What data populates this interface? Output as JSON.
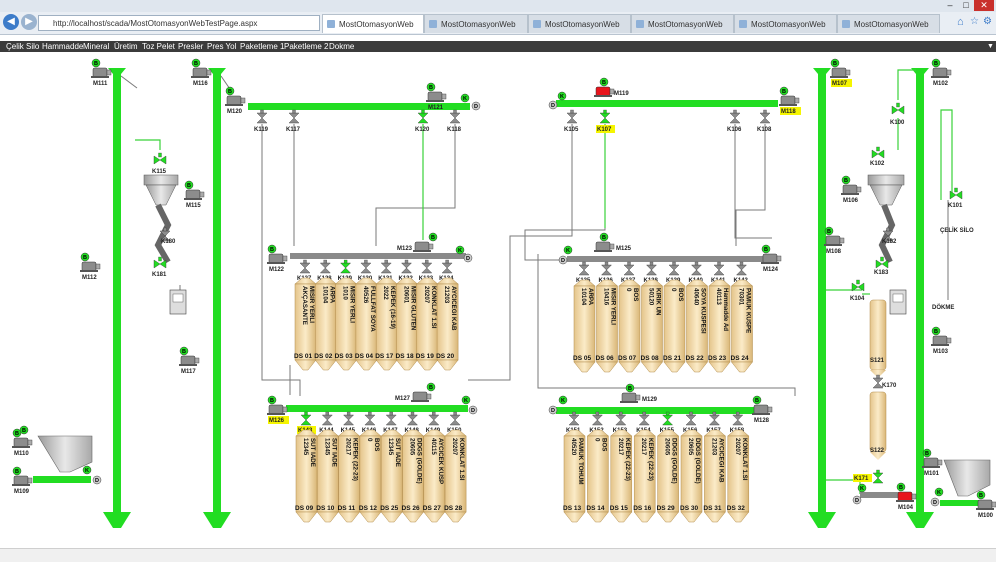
{
  "browser": {
    "url": "http://localhost/scada/MostOtomasyonWebTestPage.aspx",
    "tabs": [
      "MostOtomasyonWeb",
      "MostOtomasyonWeb",
      "MostOtomasyonWeb",
      "MostOtomasyonWeb",
      "MostOtomasyonWeb",
      "MostOtomasyonWeb"
    ],
    "window_buttons": [
      "–",
      "□",
      "✕"
    ]
  },
  "menu": [
    "Çelik Silo",
    "Hammadde",
    "Mineral",
    "Üretim",
    "Toz Pelet",
    "Presler",
    "Pres Yol",
    "Paketleme 1",
    "Paketleme 2",
    "Dokme"
  ],
  "colors": {
    "green": "#22dd22",
    "yellow": "#f5f500",
    "red": "#e8141c",
    "silo": "#f3d9a6"
  },
  "motors": [
    {
      "id": "M111",
      "highlight": false
    },
    {
      "id": "M116",
      "highlight": false
    },
    {
      "id": "M120",
      "highlight": false
    },
    {
      "id": "M121",
      "highlight": false
    },
    {
      "id": "M119",
      "highlight": false
    },
    {
      "id": "M118",
      "highlight": true
    },
    {
      "id": "M107",
      "highlight": true
    },
    {
      "id": "M102",
      "highlight": false
    },
    {
      "id": "M115",
      "highlight": false
    },
    {
      "id": "M112",
      "highlight": false
    },
    {
      "id": "M117",
      "highlight": false
    },
    {
      "id": "M110",
      "highlight": false
    },
    {
      "id": "M109",
      "highlight": false
    },
    {
      "id": "M122",
      "highlight": false
    },
    {
      "id": "M123",
      "highlight": false
    },
    {
      "id": "M125",
      "highlight": false
    },
    {
      "id": "M124",
      "highlight": false
    },
    {
      "id": "M126",
      "highlight": true
    },
    {
      "id": "M127",
      "highlight": false
    },
    {
      "id": "M129",
      "highlight": false
    },
    {
      "id": "M128",
      "highlight": false
    },
    {
      "id": "M106",
      "highlight": false
    },
    {
      "id": "M108",
      "highlight": false
    },
    {
      "id": "M103",
      "highlight": false
    },
    {
      "id": "M101",
      "highlight": false
    },
    {
      "id": "M104",
      "highlight": false
    },
    {
      "id": "M100",
      "highlight": false
    }
  ],
  "valves_left_col": [
    "K115",
    "K180",
    "K181"
  ],
  "top_left_valves": [
    "K119",
    "K117",
    "K120",
    "K118"
  ],
  "top_right_valves": [
    "K105",
    "K107",
    "K106",
    "K108"
  ],
  "right_col_valves": [
    "K100",
    "K102",
    "K182",
    "K183",
    "K104",
    "K101",
    "K170",
    "K171"
  ],
  "labels": {
    "celik_silo": "ÇELİK SİLO",
    "dokme": "DÖKME",
    "s121": "S121",
    "s122": "S122",
    "b": "B",
    "k": "K",
    "d": "D"
  },
  "silo_groups": [
    {
      "name": "upper_left",
      "valves": [
        "K127",
        "K128",
        "K129",
        "K130",
        "K131",
        "K132",
        "K133",
        "K134"
      ],
      "contents": [
        "AKÇASANTE MISIR YERLI",
        "10104 ARPA",
        "1010 MISIR YERLI",
        "40526 FULLFAT SOYA",
        "2022 KEPEK (16-19)",
        "20601 MISIR GLUTEN",
        "20207 KONKLAT 1.SI",
        "21203 AYCICEGI KAB"
      ],
      "ds": [
        "DS 01",
        "DS 02",
        "DS 03",
        "DS 04",
        "DS 17",
        "DS 18",
        "DS 19",
        "DS 20"
      ]
    },
    {
      "name": "upper_right",
      "valves": [
        "K135",
        "K136",
        "K137",
        "K138",
        "K139",
        "K140",
        "K141",
        "K142"
      ],
      "contents": [
        "10104 ARPA",
        "10416 MISIR YERLI",
        "0 BOS",
        "50120 KIRIK UN",
        "0 BOS",
        "40640 SOYA KUSPESI",
        "40113 Hammadde Ad",
        "70301 PAMUK KUSPE"
      ],
      "ds": [
        "DS 05",
        "DS 06",
        "DS 07",
        "DS 08",
        "DS 21",
        "DS 22",
        "DS 23",
        "DS 24"
      ]
    },
    {
      "name": "lower_left",
      "valves": [
        "K143",
        "K144",
        "K145",
        "K146",
        "K147",
        "K148",
        "K149",
        "K150"
      ],
      "contents": [
        "12345 SUT IADE",
        "12345 SUT IADE",
        "20217 KEPEK (22-23)",
        "0 BOS",
        "12345 SUT IADE",
        "20605 DDGS (GOLDE)",
        "40115 AYCICEK KUSP",
        "20207 KONKLAT 1.SI"
      ],
      "ds": [
        "DS 09",
        "DS 10",
        "DS 11",
        "DS 12",
        "DS 25",
        "DS 26",
        "DS 27",
        "DS 28"
      ]
    },
    {
      "name": "lower_right",
      "valves": [
        "K151",
        "K152",
        "K153",
        "K154",
        "K155",
        "K156",
        "K157",
        "K158"
      ],
      "contents": [
        "40520 PAMUK TOHUM",
        "0 BOS",
        "20217 KEPEK (22-23)",
        "20217 KEPEK (22-23)",
        "20605 DDGS (GOLDE)",
        "20605 DDGS (GOLDE)",
        "21203 AYCICEGI KAB",
        "20207 KONKLAT 1.SI"
      ],
      "ds": [
        "DS 13",
        "DS 14",
        "DS 15",
        "DS 16",
        "DS 29",
        "DS 30",
        "DS 31",
        "DS 32"
      ]
    }
  ]
}
